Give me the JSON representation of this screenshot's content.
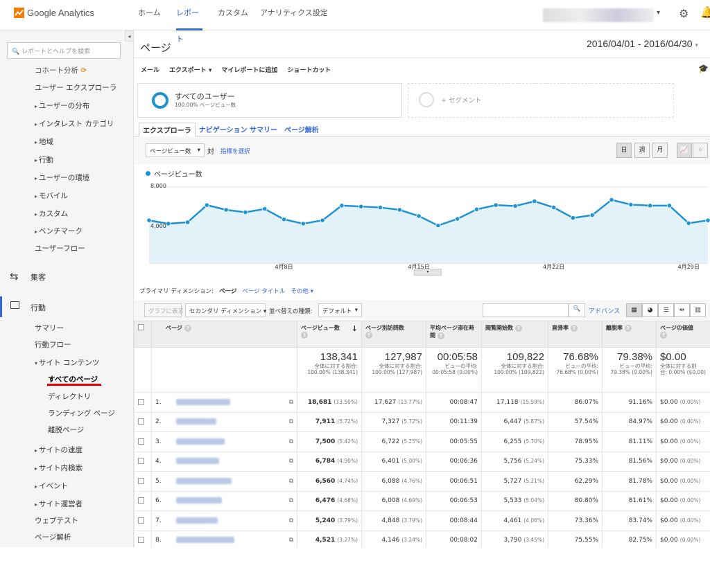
{
  "app": {
    "name": "Google Analytics",
    "brand_color": "#f57c00"
  },
  "topnav": [
    "ホーム",
    "レポート",
    "カスタム",
    "アナリティクス設定"
  ],
  "sidebar": {
    "search_placeholder": "レポートとヘルプを検索",
    "partial_item": "コホート分析",
    "audience_items": [
      "ユーザー エクスプローラ",
      "ユーザーの分布",
      "インタレスト カテゴリ",
      "地域",
      "行動",
      "ユーザーの環境",
      "モバイル",
      "カスタム",
      "ベンチマーク",
      "ユーザーフロー"
    ],
    "acquisition": "集客",
    "behavior": "行動",
    "behavior_items": [
      "サマリー",
      "行動フロー",
      "サイト コンテンツ"
    ],
    "content_items": [
      "すべてのページ",
      "ディレクトリ",
      "ランディング ページ",
      "離脱ページ"
    ],
    "behavior_more": [
      "サイトの速度",
      "サイト内検索",
      "イベント",
      "サイト運営者",
      "ウェブテスト",
      "ページ解析"
    ]
  },
  "main": {
    "title": "ページ",
    "date_range": "2016/04/01 - 2016/04/30",
    "actions": [
      "メール",
      "エクスポート ▾",
      "マイレポートに追加",
      "ショートカット"
    ],
    "segment": {
      "name": "すべてのユーザー",
      "sub": "100.00% ページビュー数",
      "add": "+ セグメント"
    },
    "tabs": [
      "エクスプローラ",
      "ナビゲーション サマリー",
      "ページ解析"
    ],
    "metric_dropdown": "ページビュー数",
    "vs": "対",
    "pick_metric": "指標を選択",
    "time_buttons": [
      "日",
      "週",
      "月"
    ],
    "legend": "ページビュー数"
  },
  "chart_data": {
    "type": "area",
    "series": [
      {
        "name": "ページビュー数",
        "values": [
          4500,
          4150,
          4300,
          6100,
          5600,
          5350,
          5700,
          4600,
          4150,
          4500,
          6050,
          5950,
          5850,
          5600,
          4950,
          3950,
          4650,
          5650,
          6100,
          6000,
          6500,
          5850,
          4750,
          5050,
          6650,
          6150,
          6050,
          6050,
          4200,
          4500
        ]
      }
    ],
    "x_ticks": [
      "4月8日",
      "4月15日",
      "4月22日",
      "4月29日"
    ],
    "y_ticks": [
      "8,000",
      "4,000"
    ],
    "ylim": [
      0,
      8000
    ],
    "color": "#1f92d1"
  },
  "dimension": {
    "label": "プライマリ ディメンション:",
    "current": "ページ",
    "link1": "ページ タイトル",
    "link2": "その他 ▾"
  },
  "toolbar": {
    "graph": "グラフに表示",
    "secondary": "セカンダリ ディメンション",
    "sort_label": "並べ替えの種類:",
    "sort_value": "デフォルト",
    "advance": "アドバンス"
  },
  "table": {
    "headers": [
      "ページ",
      "ページビュー数",
      "ページ別訪問数",
      "平均ページ滞在時間",
      "閲覧開始数",
      "直帰率",
      "離脱率",
      "ページの価値"
    ],
    "totals": [
      {
        "big": "138,341",
        "sm1": "全体に対する割合:",
        "sm2": "100.00% (138,341)"
      },
      {
        "big": "127,987",
        "sm1": "全体に対する割合:",
        "sm2": "100.00% (127,987)"
      },
      {
        "big": "00:05:58",
        "sm1": "ビューの平均:",
        "sm2": "00:05:58 (0.00%)"
      },
      {
        "big": "109,822",
        "sm1": "全体に対する割合:",
        "sm2": "100.00% (109,822)"
      },
      {
        "big": "76.68%",
        "sm1": "ビューの平均:",
        "sm2": "76.68% (0.00%)"
      },
      {
        "big": "79.38%",
        "sm1": "ビューの平均:",
        "sm2": "79.38% (0.00%)"
      },
      {
        "big": "$0.00",
        "sm1": "全体に対する割",
        "sm2": "合: 0.00% ($0.00)"
      }
    ],
    "rows": [
      [
        "1.",
        "18,681",
        "(13.50%)",
        "17,627",
        "(13.77%)",
        "00:08:47",
        "17,118",
        "(15.59%)",
        "86.07%",
        "91.16%",
        "$0.00",
        "(0.00%)"
      ],
      [
        "2.",
        "7,911",
        "(5.72%)",
        "7,327",
        "(5.72%)",
        "00:11:39",
        "6,447",
        "(5.87%)",
        "57.54%",
        "84.97%",
        "$0.00",
        "(0.00%)"
      ],
      [
        "3.",
        "7,500",
        "(5.42%)",
        "6,722",
        "(5.25%)",
        "00:05:55",
        "6,255",
        "(5.70%)",
        "78.95%",
        "81.11%",
        "$0.00",
        "(0.00%)"
      ],
      [
        "4.",
        "6,784",
        "(4.90%)",
        "6,401",
        "(5.00%)",
        "00:06:36",
        "5,756",
        "(5.24%)",
        "75.33%",
        "81.56%",
        "$0.00",
        "(0.00%)"
      ],
      [
        "5.",
        "6,560",
        "(4.74%)",
        "6,088",
        "(4.76%)",
        "00:06:51",
        "5,727",
        "(5.21%)",
        "62.29%",
        "81.78%",
        "$0.00",
        "(0.00%)"
      ],
      [
        "6.",
        "6,476",
        "(4.68%)",
        "6,008",
        "(4.69%)",
        "00:06:53",
        "5,533",
        "(5.04%)",
        "80.80%",
        "81.61%",
        "$0.00",
        "(0.00%)"
      ],
      [
        "7.",
        "5,240",
        "(3.79%)",
        "4,848",
        "(3.79%)",
        "00:08:44",
        "4,461",
        "(4.06%)",
        "73.36%",
        "83.74%",
        "$0.00",
        "(0.00%)"
      ],
      [
        "8.",
        "4,521",
        "(3.27%)",
        "4,146",
        "(3.24%)",
        "00:08:02",
        "3,790",
        "(3.45%)",
        "75.55%",
        "82.75%",
        "$0.00",
        "(0.00%)"
      ]
    ]
  }
}
